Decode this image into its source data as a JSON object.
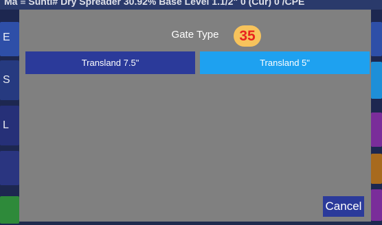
{
  "background": {
    "topbar_text": "Ma ≡  Sunti#    Dry Spreader 30.92%   Base Level 1.1/2\"  0 (Cur)   0 /CPE",
    "left_tile_letters": [
      "E",
      "S",
      "L"
    ]
  },
  "dialog": {
    "title": "Gate Type",
    "badge": "35",
    "options": [
      {
        "label": "Transland 7.5\""
      },
      {
        "label": "Transland 5\""
      }
    ],
    "cancel_label": "Cancel"
  },
  "colors": {
    "modal_bg": "#808080",
    "option_default": "#2b3a9a",
    "option_selected": "#1ea1f0",
    "badge_bg": "#f7c35c",
    "badge_text": "#e8231e"
  }
}
